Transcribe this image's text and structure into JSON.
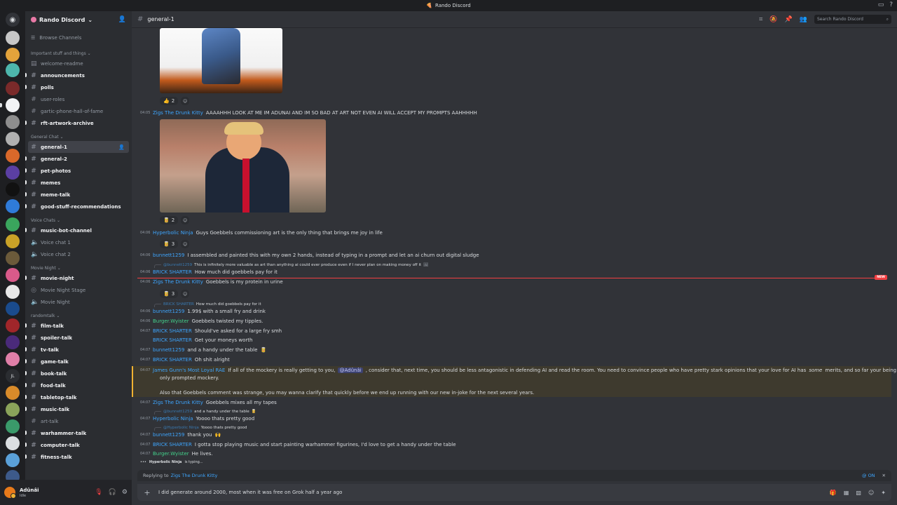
{
  "window": {
    "title": "Rando Discord"
  },
  "server": {
    "name": "Rando Discord",
    "browse_label": "Browse Channels"
  },
  "sidebar": {
    "categories": {
      "important": "Important stuff and things",
      "general": "General Chat",
      "voice": "Voice Chats",
      "movie": "Movie Night",
      "random": "randomtalk"
    },
    "channels": {
      "welcome": "welcome-readme",
      "announcements": "announcements",
      "polls": "polls",
      "user_roles": "user-roles",
      "gartic": "gartic-phone-hall-of-fame",
      "rft": "rft-artwork-archive",
      "general1": "general-1",
      "general2": "general-2",
      "pet": "pet-photos",
      "memes": "memes",
      "meme_talk": "meme-talk",
      "good_stuff": "good-stuff-recommendations",
      "music_bot": "music-bot-channel",
      "voice1": "Voice chat 1",
      "voice2": "Voice chat 2",
      "movie_night": "movie-night",
      "movie_stage": "Movie Night Stage",
      "movie_voice": "Movie Night",
      "film": "film-talk",
      "spoiler": "spoiler-talk",
      "tv": "tv-talk",
      "game": "game-talk",
      "book": "book-talk",
      "food": "food-talk",
      "tabletop": "tabletop-talk",
      "music": "music-talk",
      "art": "art-talk",
      "warhammer": "warhammer-talk",
      "computer": "computer-talk",
      "fitness": "fitness-talk"
    }
  },
  "user": {
    "name": "Adûnâi",
    "status": "Idle"
  },
  "header": {
    "channel": "general-1",
    "search_placeholder": "Search Rando Discord"
  },
  "messages": {
    "r1": {
      "emoji": "👍",
      "count": "2"
    },
    "m1": {
      "ts": "04:05",
      "author": "Zigs The Drunk Kitty",
      "text": "AAAAHHH LOOK AT ME IM ADUNAI AND IM SO BAD AT ART NOT EVEN AI WILL ACCEPT MY PROMPTS AAHHHHH"
    },
    "r2": {
      "emoji": "🥫",
      "count": "2"
    },
    "m2": {
      "ts": "04:06",
      "author": "Hyperbolic Ninja",
      "text": "Guys Goebbels commissioning art is the only thing that brings me joy in life"
    },
    "r3": {
      "emoji": "🥫",
      "count": "3"
    },
    "m3": {
      "ts": "04:06",
      "author": "bunnett1259",
      "text": "I assembled and painted this with my own 2 hands, instead of typing in a prompt and let an ai churn out digital sludge"
    },
    "m4_reply": {
      "author": "@bunnett1259",
      "text": "This is infinitely more valuable as art than anything ai could ever produce even if I never plan on making money off it"
    },
    "m4": {
      "ts": "04:06",
      "author": "BRICK SHARTER",
      "text": "How much did goebbels pay for it"
    },
    "new_label": "NEW",
    "m5": {
      "ts": "04:06",
      "author": "Zigs The Drunk Kitty",
      "text": "Goebbels is my protein in urine"
    },
    "r5": {
      "emoji": "🥫",
      "count": "3"
    },
    "m6_reply": {
      "author": "BRICK SHARTER",
      "text": "How much did goebbels pay for it"
    },
    "m6": {
      "ts": "04:06",
      "author": "bunnett1259",
      "text": "1.99$ with a small fry and drink"
    },
    "m7": {
      "ts": "04:06",
      "author": "Burger.Wyister",
      "text": "Goebbels twisted my tipples."
    },
    "m8": {
      "ts": "04:07",
      "author": "BRICK SHARTER",
      "text": "Should've asked for a large fry smh"
    },
    "m9": {
      "author": "BRICK SHARTER",
      "text": "Get your moneys worth"
    },
    "m10": {
      "ts": "04:07",
      "author": "bunnett1259",
      "text": "and a handy under the table"
    },
    "m11": {
      "ts": "04:07",
      "author": "BRICK SHARTER",
      "text": "Oh shit alright"
    },
    "m12": {
      "ts": "04:07",
      "author": "James Gunn's Most Loyal RAE",
      "text_a": "If all of the mockery is really getting to you,",
      "mention": "@Adûnâi",
      "text_b": ", consider that, next time, you should be less antagonistic in defending AI and read the room. You need to convince people who have pretty stark opinions that your love for AI has",
      "em": "some",
      "text_c": "merits, and so far your being a dick has",
      "line2": "only prompted mockery.",
      "line3": "Also that Goebbels comment was strange, you may wanna clarify that quickly before we end up running with our new in-joke for the next several years."
    },
    "m13": {
      "ts": "04:07",
      "author": "Zigs The Drunk Kitty",
      "text": "Goebbels mixes all my tapes"
    },
    "m14_reply": {
      "author": "@bunnett1259",
      "text": "and a handy under the table"
    },
    "m14": {
      "ts": "04:07",
      "author": "Hyperbolic Ninja",
      "text": "Yoooo thats pretty good"
    },
    "m15_reply": {
      "author": "@Hyperbolic Ninja",
      "text": "Yoooo thats pretty good"
    },
    "m15": {
      "ts": "04:07",
      "author": "bunnett1259",
      "text": "thank you"
    },
    "m16": {
      "ts": "04:07",
      "author": "BRICK SHARTER",
      "text": "I gotta stop playing music and start painting warhammer figurines, I'd love to get a handy under the table"
    },
    "m17": {
      "ts": "04:07",
      "author": "Burger.Wyister",
      "text": "He lives."
    },
    "typing": {
      "name": "Hyperbolic Ninja",
      "text": "is typing..."
    }
  },
  "composer": {
    "replying_prefix": "Replying to",
    "replying_to": "Zigs The Drunk Kitty",
    "mention_toggle": "@ ON",
    "draft": "I did generate around 2000, most when it was free on Grok half a year ago"
  },
  "colors": {
    "link_blue": "#3ea6ff",
    "green_role": "#43d18b",
    "unread_red": "#f23f42",
    "mention_bg": "#3e3a2e"
  }
}
